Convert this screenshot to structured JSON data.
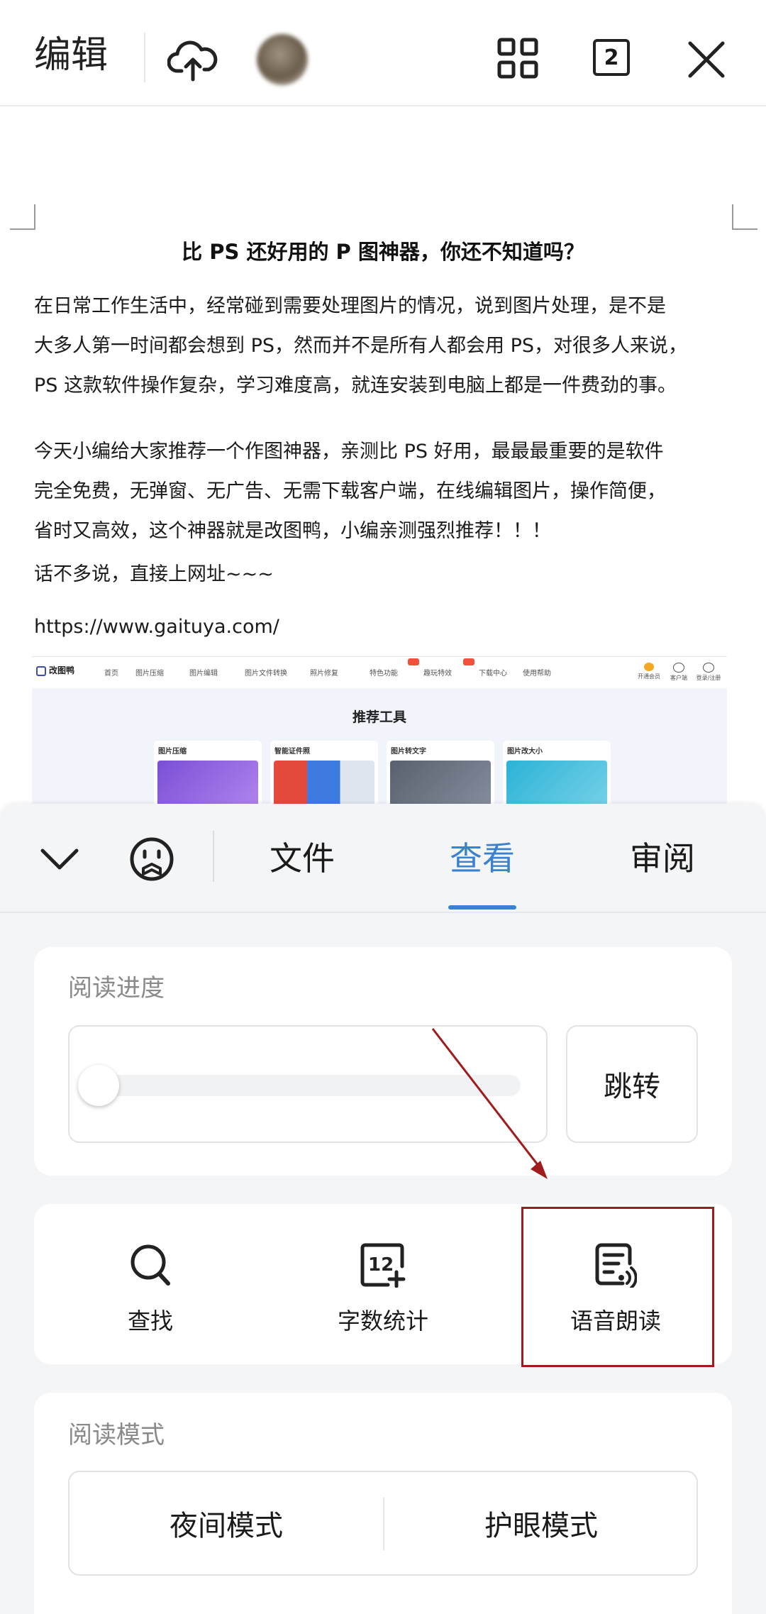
{
  "topbar": {
    "title": "编辑",
    "page_count": "2",
    "icons": [
      "cloud-upload-icon",
      "avatar",
      "grid-icon",
      "page-count-icon",
      "close-icon"
    ]
  },
  "document": {
    "title": "比 PS 还好用的 P 图神器，你还不知道吗？",
    "paragraphs": [
      "在日常工作生活中，经常碰到需要处理图片的情况，说到图片处理，是不是\n大多人第一时间都会想到 PS，然而并不是所有人都会用 PS，对很多人来说，\nPS 这款软件操作复杂，学习难度高，就连安装到电脑上都是一件费劲的事。",
      "今天小编给大家推荐一个作图神器，亲测比 PS 好用，最最最重要的是软件\n完全免费，无弹窗、无广告、无需下载客户端，在线编辑图片，操作简便，\n省时又高效，这个神器就是改图鸭，小编亲测强烈推荐！！！",
      "话不多说，直接上网址~~~",
      "https://www.gaituya.com/"
    ],
    "embedded_image": {
      "logo": "改图鸭",
      "nav": [
        "首页",
        "图片压缩",
        "图片编辑",
        "图片文件转换",
        "照片修复",
        "特色功能",
        "趣玩特效",
        "下载中心",
        "使用帮助"
      ],
      "right_links": [
        "开通会员",
        "客户端",
        "登录/注册"
      ],
      "heading": "推荐工具",
      "cards": [
        "图片压缩",
        "智能证件照",
        "图片转文字",
        "图片改大小"
      ]
    }
  },
  "sheet": {
    "tabs": [
      {
        "label": "文件",
        "active": false
      },
      {
        "label": "查看",
        "active": true
      },
      {
        "label": "审阅",
        "active": false
      }
    ],
    "reading_progress": {
      "label": "阅读进度",
      "progress": 0,
      "jump_label": "跳转"
    },
    "tools": [
      {
        "label": "查找",
        "icon": "search-icon"
      },
      {
        "label": "字数统计",
        "icon": "word-count-icon"
      },
      {
        "label": "语音朗读",
        "icon": "read-aloud-icon"
      }
    ],
    "reading_mode": {
      "label": "阅读模式",
      "night": "夜间模式",
      "eye_care": "护眼模式"
    }
  },
  "colors": {
    "accent": "#3a82d0",
    "annotation": "#a01c1c",
    "sheet_bg": "#f4f5f7"
  }
}
